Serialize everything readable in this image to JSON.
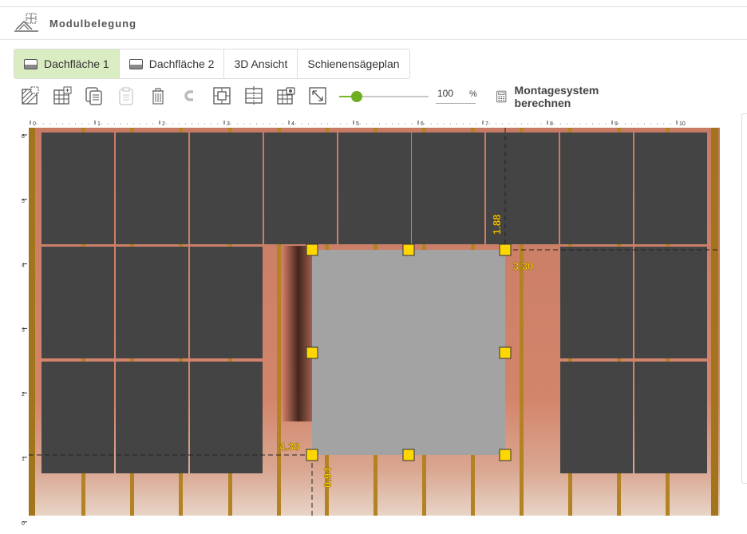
{
  "header": {
    "title": "Modulbelegung",
    "logo_icon": "roof-grid-icon"
  },
  "tabs": [
    {
      "label": "Dachfläche 1",
      "active": true
    },
    {
      "label": "Dachfläche 2",
      "active": false
    },
    {
      "label": "3D Ansicht",
      "active": false
    },
    {
      "label": "Schienensägeplan",
      "active": false
    }
  ],
  "toolbar": {
    "icons": [
      "diagonal-select-icon",
      "grid-add-icon",
      "copy-icon",
      "paste-icon",
      "trash-icon",
      "magnet-icon",
      "center-icon",
      "split-vertical-icon",
      "grid-camera-icon",
      "fullscreen-icon"
    ],
    "zoom_value": "100",
    "zoom_unit": "%",
    "zoom_fraction": 0.2,
    "calc_label": "Montagesystem berechnen",
    "accent": "#7ab52e"
  },
  "ruler": {
    "x_labels": [
      "0",
      "1",
      "2",
      "3",
      "4",
      "5",
      "6",
      "7",
      "8",
      "9",
      "10"
    ],
    "y_labels": [
      "6",
      "5",
      "4",
      "3",
      "2",
      "1",
      "0"
    ]
  },
  "dimensions": {
    "top": "1.88",
    "right": "3.30",
    "left": "4.38",
    "bottom": "0.94"
  },
  "colors": {
    "module": "#444444",
    "obstacle": "#a3a3a3",
    "handle": "#ffd700",
    "roof": "#c97a62",
    "dimension": "#ffd600"
  }
}
